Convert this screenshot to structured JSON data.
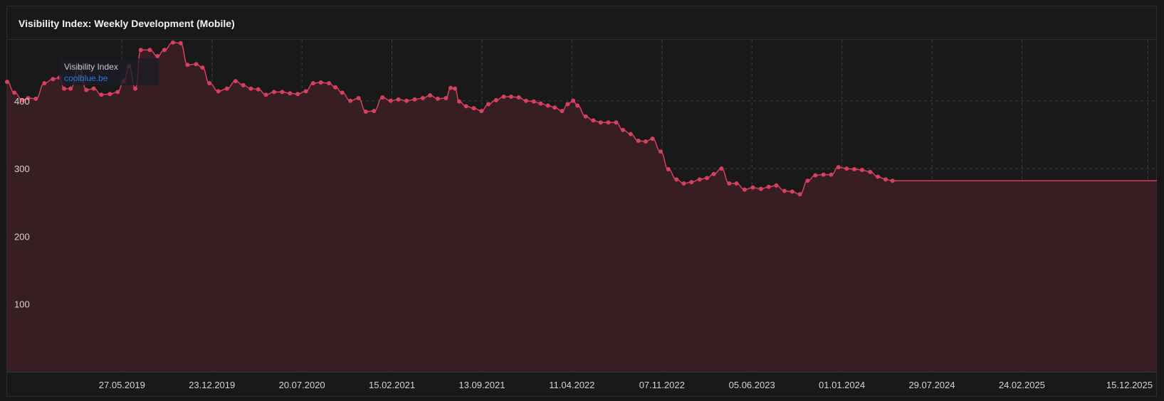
{
  "title": "Visibility Index: Weekly Development (Mobile)",
  "legend": {
    "label": "Visibility Index",
    "domain": "coolblue.be"
  },
  "colors": {
    "line": "#d8405f",
    "area": "#3a1f25",
    "grid": "#3b3e4e",
    "tick_text": "#d4d4d4"
  },
  "chart_data": {
    "type": "area",
    "title": "Visibility Index: Weekly Development (Mobile)",
    "xlabel": "",
    "ylabel": "",
    "x_type": "date",
    "xlim": [
      "2018-09-01",
      "2026-01-05"
    ],
    "ylim": [
      0,
      490
    ],
    "y_ticks": [
      100,
      200,
      300,
      400
    ],
    "x_ticks": [
      "27.05.2019",
      "23.12.2019",
      "20.07.2020",
      "15.02.2021",
      "13.09.2021",
      "11.04.2022",
      "07.11.2022",
      "05.06.2023",
      "01.01.2024",
      "29.07.2024",
      "24.02.2025",
      "15.12.2025"
    ],
    "grid": true,
    "legend_position": "top-left",
    "markers": true,
    "series": [
      {
        "name": "coolblue.be",
        "points": [
          [
            "2018-09-01",
            428
          ],
          [
            "2018-09-18",
            412
          ],
          [
            "2018-10-07",
            401
          ],
          [
            "2018-10-20",
            404
          ],
          [
            "2018-11-07",
            403
          ],
          [
            "2018-11-27",
            426
          ],
          [
            "2018-12-17",
            432
          ],
          [
            "2019-01-01",
            434
          ],
          [
            "2019-01-12",
            418
          ],
          [
            "2019-01-27",
            418
          ],
          [
            "2019-02-16",
            450
          ],
          [
            "2019-03-05",
            416
          ],
          [
            "2019-03-22",
            418
          ],
          [
            "2019-04-09",
            409
          ],
          [
            "2019-04-29",
            410
          ],
          [
            "2019-05-17",
            413
          ],
          [
            "2019-05-31",
            429
          ],
          [
            "2019-06-13",
            451
          ],
          [
            "2019-06-27",
            418
          ],
          [
            "2019-07-10",
            475
          ],
          [
            "2019-07-31",
            475
          ],
          [
            "2019-08-18",
            466
          ],
          [
            "2019-09-03",
            475
          ],
          [
            "2019-09-23",
            486
          ],
          [
            "2019-10-11",
            485
          ],
          [
            "2019-10-27",
            453
          ],
          [
            "2019-11-16",
            454
          ],
          [
            "2019-12-01",
            449
          ],
          [
            "2019-12-17",
            426
          ],
          [
            "2020-01-07",
            414
          ],
          [
            "2020-01-27",
            418
          ],
          [
            "2020-02-16",
            429
          ],
          [
            "2020-03-05",
            423
          ],
          [
            "2020-03-23",
            418
          ],
          [
            "2020-04-09",
            417
          ],
          [
            "2020-04-27",
            409
          ],
          [
            "2020-05-16",
            413
          ],
          [
            "2020-06-04",
            413
          ],
          [
            "2020-06-22",
            411
          ],
          [
            "2020-07-10",
            410
          ],
          [
            "2020-07-29",
            414
          ],
          [
            "2020-08-15",
            426
          ],
          [
            "2020-09-02",
            427
          ],
          [
            "2020-09-21",
            426
          ],
          [
            "2020-10-06",
            420
          ],
          [
            "2020-10-22",
            412
          ],
          [
            "2020-11-10",
            400
          ],
          [
            "2020-11-29",
            404
          ],
          [
            "2020-12-16",
            384
          ],
          [
            "2021-01-04",
            385
          ],
          [
            "2021-01-24",
            405
          ],
          [
            "2021-02-12",
            400
          ],
          [
            "2021-03-02",
            402
          ],
          [
            "2021-03-21",
            400
          ],
          [
            "2021-04-09",
            402
          ],
          [
            "2021-04-28",
            404
          ],
          [
            "2021-05-15",
            408
          ],
          [
            "2021-06-02",
            403
          ],
          [
            "2021-06-21",
            404
          ],
          [
            "2021-07-02",
            419
          ],
          [
            "2021-07-12",
            418
          ],
          [
            "2021-07-22",
            399
          ],
          [
            "2021-08-07",
            392
          ],
          [
            "2021-08-25",
            389
          ],
          [
            "2021-09-12",
            385
          ],
          [
            "2021-09-28",
            395
          ],
          [
            "2021-10-16",
            401
          ],
          [
            "2021-11-03",
            406
          ],
          [
            "2021-11-20",
            406
          ],
          [
            "2021-12-08",
            405
          ],
          [
            "2021-12-25",
            400
          ],
          [
            "2022-01-12",
            399
          ],
          [
            "2022-01-28",
            396
          ],
          [
            "2022-02-14",
            393
          ],
          [
            "2022-03-02",
            390
          ],
          [
            "2022-03-19",
            385
          ],
          [
            "2022-04-01",
            395
          ],
          [
            "2022-04-14",
            400
          ],
          [
            "2022-04-24",
            393
          ],
          [
            "2022-05-13",
            377
          ],
          [
            "2022-05-31",
            371
          ],
          [
            "2022-06-17",
            368
          ],
          [
            "2022-07-05",
            368
          ],
          [
            "2022-07-23",
            368
          ],
          [
            "2022-08-08",
            357
          ],
          [
            "2022-08-26",
            351
          ],
          [
            "2022-09-13",
            341
          ],
          [
            "2022-09-30",
            340
          ],
          [
            "2022-10-16",
            344
          ],
          [
            "2022-11-04",
            325
          ],
          [
            "2022-11-22",
            299
          ],
          [
            "2022-12-11",
            284
          ],
          [
            "2022-12-28",
            278
          ],
          [
            "2023-01-15",
            280
          ],
          [
            "2023-02-03",
            284
          ],
          [
            "2023-02-20",
            286
          ],
          [
            "2023-03-08",
            292
          ],
          [
            "2023-03-26",
            300
          ],
          [
            "2023-04-13",
            278
          ],
          [
            "2023-04-30",
            278
          ],
          [
            "2023-05-19",
            269
          ],
          [
            "2023-06-07",
            272
          ],
          [
            "2023-06-26",
            270
          ],
          [
            "2023-07-14",
            273
          ],
          [
            "2023-08-01",
            275
          ],
          [
            "2023-08-20",
            267
          ],
          [
            "2023-09-07",
            266
          ],
          [
            "2023-09-25",
            262
          ],
          [
            "2023-10-13",
            282
          ],
          [
            "2023-10-31",
            290
          ],
          [
            "2023-11-19",
            291
          ],
          [
            "2023-12-07",
            291
          ],
          [
            "2023-12-24",
            302
          ],
          [
            "2024-01-12",
            300
          ],
          [
            "2024-01-30",
            299
          ],
          [
            "2024-02-17",
            298
          ],
          [
            "2024-03-07",
            295
          ],
          [
            "2024-03-25",
            288
          ],
          [
            "2024-04-12",
            284
          ],
          [
            "2024-04-28",
            282
          ]
        ]
      }
    ]
  }
}
